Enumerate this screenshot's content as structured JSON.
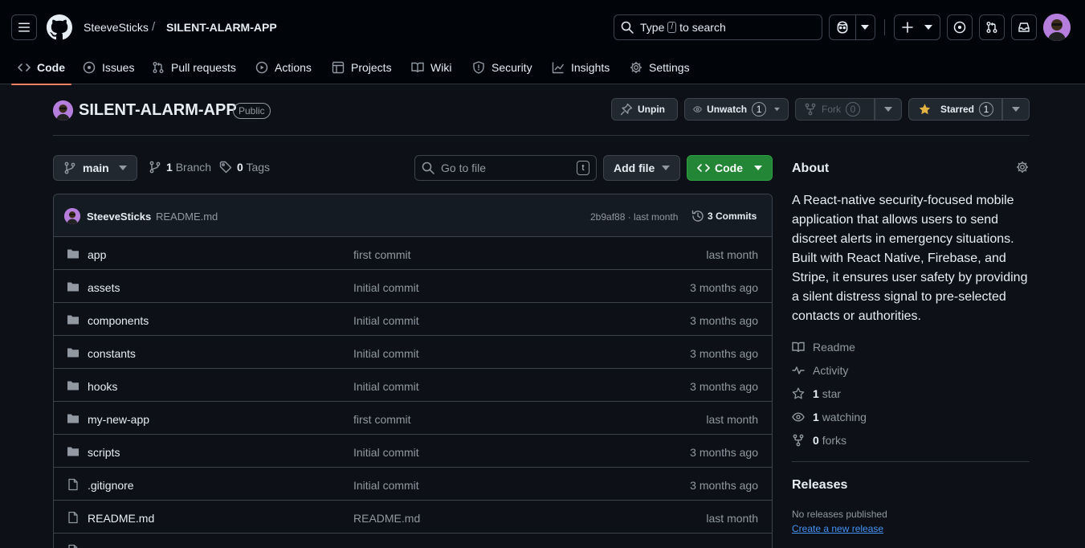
{
  "colors": {
    "background": "#0d1117",
    "header_bg": "#010409",
    "border": "#3d444d",
    "text": "#e6edf3",
    "muted": "#9198a1",
    "accent_underline": "#f78166",
    "code_button": "#238636",
    "link": "#4493f8",
    "star": "#e3b341"
  },
  "header": {
    "owner": "SteeveSticks",
    "separator": "/",
    "repo": "SILENT-ALARM-APP",
    "search_prefix": "Type",
    "search_key": "/",
    "search_suffix": "to search"
  },
  "nav": {
    "code": "Code",
    "issues": "Issues",
    "pull_requests": "Pull requests",
    "actions": "Actions",
    "projects": "Projects",
    "wiki": "Wiki",
    "security": "Security",
    "insights": "Insights",
    "settings": "Settings"
  },
  "repo": {
    "title": "SILENT-ALARM-APP",
    "visibility": "Public",
    "unpin": "Unpin",
    "unwatch": "Unwatch",
    "watch_count": "1",
    "fork": "Fork",
    "fork_count": "0",
    "starred": "Starred",
    "star_count": "1"
  },
  "toolbar": {
    "branch": "main",
    "branch_count": "1",
    "branch_label": "Branch",
    "tag_count": "0",
    "tag_label": "Tags",
    "goto_placeholder": "Go to file",
    "goto_key": "t",
    "add_file": "Add file",
    "code": "Code"
  },
  "commit": {
    "user": "SteeveSticks",
    "message": "README.md",
    "hash_time": "2b9af88 · last month",
    "commits": "3 Commits"
  },
  "files": [
    {
      "name": "app",
      "type": "folder",
      "message": "first commit",
      "date": "last month"
    },
    {
      "name": "assets",
      "type": "folder",
      "message": "Initial commit",
      "date": "3 months ago"
    },
    {
      "name": "components",
      "type": "folder",
      "message": "Initial commit",
      "date": "3 months ago"
    },
    {
      "name": "constants",
      "type": "folder",
      "message": "Initial commit",
      "date": "3 months ago"
    },
    {
      "name": "hooks",
      "type": "folder",
      "message": "Initial commit",
      "date": "3 months ago"
    },
    {
      "name": "my-new-app",
      "type": "folder",
      "message": "first commit",
      "date": "last month"
    },
    {
      "name": "scripts",
      "type": "folder",
      "message": "Initial commit",
      "date": "3 months ago"
    },
    {
      "name": ".gitignore",
      "type": "file",
      "message": "Initial commit",
      "date": "3 months ago"
    },
    {
      "name": "README.md",
      "type": "file",
      "message": "README.md",
      "date": "last month"
    }
  ],
  "about": {
    "title": "About",
    "description": "A React-native security-focused mobile application that allows users to send discreet alerts in emergency situations. Built with React Native, Firebase, and Stripe, it ensures user safety by providing a silent distress signal to pre-selected contacts or authorities.",
    "readme": "Readme",
    "activity": "Activity",
    "stars_count": "1",
    "stars_label": "star",
    "watching_count": "1",
    "watching_label": "watching",
    "forks_count": "0",
    "forks_label": "forks"
  },
  "releases": {
    "title": "Releases",
    "none": "No releases published",
    "create": "Create a new release"
  }
}
